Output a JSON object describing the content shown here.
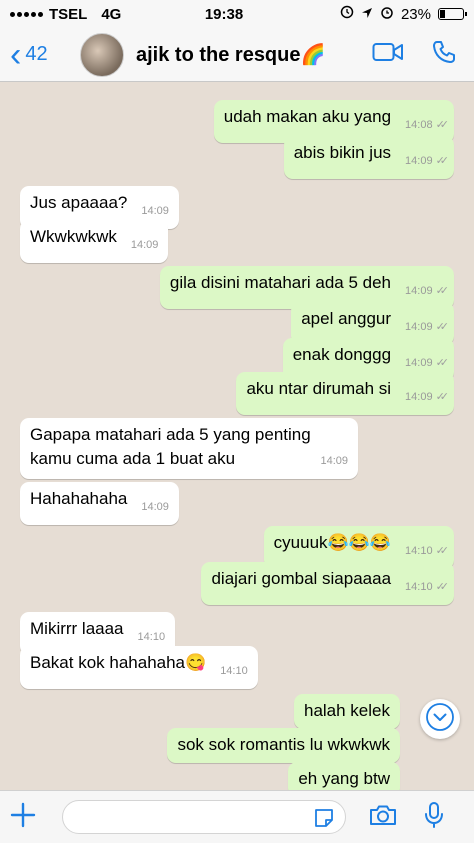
{
  "status_bar": {
    "carrier": "TSEL",
    "network": "4G",
    "time": "19:38",
    "battery": "23%",
    "battery_level": 0.23
  },
  "header": {
    "back_count": "42",
    "contact_name": "ajik to the resque🌈"
  },
  "messages": [
    {
      "dir": "out",
      "text": "udah makan aku yang",
      "time": "14:08"
    },
    {
      "dir": "out",
      "text": "abis bikin jus",
      "time": "14:09"
    },
    {
      "dir": "in",
      "text": "Jus apaaaa?",
      "time": "14:09"
    },
    {
      "dir": "in",
      "text": "Wkwkwkwk",
      "time": "14:09"
    },
    {
      "dir": "out",
      "text": "gila disini matahari ada 5 deh",
      "time": "14:09"
    },
    {
      "dir": "out",
      "text": "apel anggur",
      "time": "14:09"
    },
    {
      "dir": "out",
      "text": "enak donggg",
      "time": "14:09"
    },
    {
      "dir": "out",
      "text": "aku ntar dirumah si",
      "time": "14:09"
    },
    {
      "dir": "in",
      "text": "Gapapa matahari ada 5 yang penting kamu cuma ada 1 buat aku",
      "time": "14:09"
    },
    {
      "dir": "in",
      "text": "Hahahahaha",
      "time": "14:09"
    },
    {
      "dir": "out",
      "text": "cyuuuk😂😂😂",
      "time": "14:10"
    },
    {
      "dir": "out",
      "text": "diajari gombal siapaaaa",
      "time": "14:10"
    },
    {
      "dir": "in",
      "text": "Mikirrr laaaa",
      "time": "14:10"
    },
    {
      "dir": "in",
      "text": "Bakat kok hahahaha😋",
      "time": "14:10"
    },
    {
      "dir": "out",
      "text": "halah kelek",
      "time": ""
    },
    {
      "dir": "out",
      "text": "sok sok romantis lu wkwkwk",
      "time": ""
    },
    {
      "dir": "out",
      "text": "eh yang btw",
      "time": ""
    }
  ],
  "icons": {
    "back": "chevron-left-icon",
    "video": "video-call-icon",
    "phone": "phone-icon",
    "scroll": "chevron-down-icon",
    "attach": "plus-icon",
    "sticker": "sticker-icon",
    "camera": "camera-icon",
    "mic": "microphone-icon"
  },
  "colors": {
    "accent": "#1e7fe3",
    "outgoing_bubble": "#dcf8c6",
    "incoming_bubble": "#ffffff",
    "wallpaper": "#e6ddd4"
  }
}
